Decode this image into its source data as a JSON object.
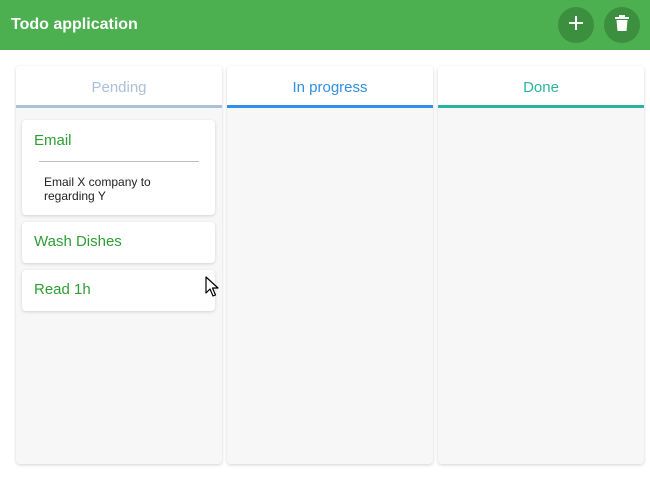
{
  "app": {
    "title": "Todo application"
  },
  "actions": {
    "add_icon": "plus-icon",
    "delete_icon": "trash-icon"
  },
  "columns": [
    {
      "label": "Pending",
      "color": "#aac1d8"
    },
    {
      "label": "In progress",
      "color": "#2e90e8"
    },
    {
      "label": "Done",
      "color": "#2ab3a4"
    }
  ],
  "cards": [
    {
      "title": "Email",
      "description": "Email X company to regarding Y"
    },
    {
      "title": "Wash Dishes"
    },
    {
      "title": "Read 1h"
    }
  ],
  "colors": {
    "appbar": "#4caf50",
    "fab": "#3c8f3f",
    "card_title": "#2e9e34"
  }
}
